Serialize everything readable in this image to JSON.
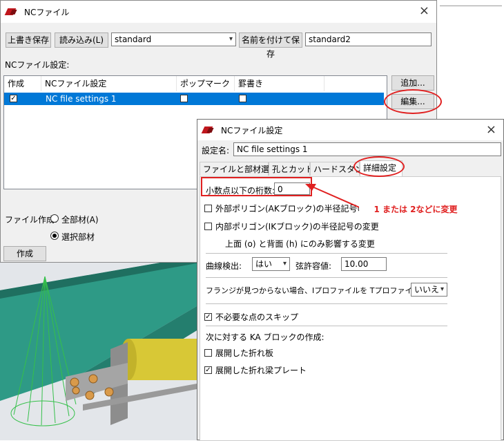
{
  "nc_window": {
    "title": "NCファイル",
    "toolbar": {
      "overwrite_save": "上書き保存",
      "load": "読み込み(L)",
      "preset_value": "standard",
      "save_as": "名前を付けて保存",
      "save_as_name": "standard2"
    },
    "settings_label": "NCファイル設定:",
    "list": {
      "columns": [
        "作成",
        "NCファイル設定",
        "ポップマーク",
        "罫書き"
      ],
      "rows": [
        {
          "create": true,
          "name": "NC file settings 1",
          "pop_mark": false,
          "scribing": false
        }
      ]
    },
    "add_button": "追加...",
    "edit_button": "編集...",
    "file_create_label": "ファイル作成:",
    "radio_all": "全部材(A)",
    "radio_selected": "選択部材",
    "create_button": "作成"
  },
  "dialog": {
    "title": "NCファイル設定",
    "setting_name_label": "設定名:",
    "setting_name_value": "NC file settings 1",
    "tabs": [
      "ファイルと部材選別",
      "孔とカット",
      "ハードスタンプ",
      "詳細設定"
    ],
    "active_tab": "詳細設定",
    "decimal_label": "小数点以下の桁数:",
    "decimal_value": "0",
    "outer_polygon_label": "外部ポリゴン(AKブロック)の半径記号の変更",
    "inner_polygon_label": "内部ポリゴン(IKブロック)の半径記号の変更",
    "top_back_note": "上面 (o) と背面 (h) にのみ影響する変更",
    "curve_detect_label": "曲線検出:",
    "curve_detect_value": "はい",
    "chord_tol_label": "弦許容値:",
    "chord_tol_value": "10.00",
    "flange_label": "フランジが見つからない場合、Iプロファイルを Tプロファイルに変換:",
    "flange_value": "いいえ",
    "skip_points_label": "不必要な点のスキップ",
    "ka_block_label": "次に対する KA ブロックの作成:",
    "unfolded_plate_label": "展開した折れ板",
    "unfolded_beam_label": "展開した折れ梁プレート"
  },
  "annotation": {
    "text": "1 または 2などに変更"
  },
  "colors": {
    "selection": "#0078d7",
    "annotation_red": "#e02020",
    "beam_teal": "#2e9a86",
    "tube_yellow": "#d8c836"
  }
}
